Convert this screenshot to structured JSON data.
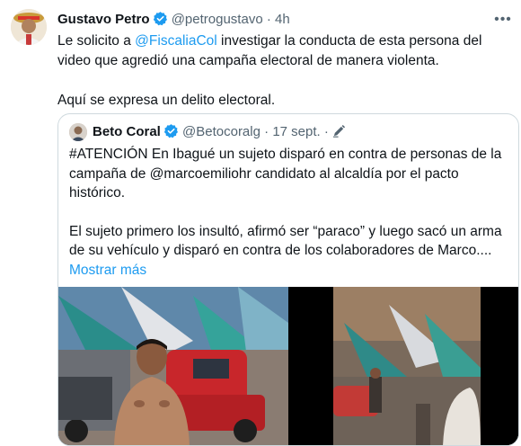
{
  "tweet": {
    "author_name": "Gustavo Petro",
    "handle": "@petrogustavo",
    "separator": "·",
    "time": "4h",
    "text_before": "Le solicito a ",
    "mention": "@FiscaliaCol",
    "text_after": " investigar la conducta de esta persona del video que agredió una campaña electoral de manera violenta.",
    "text_line2": "Aquí se expresa un delito electoral.",
    "more_icon": "more-dots-icon"
  },
  "quote": {
    "author_name": "Beto Coral",
    "handle": "@Betocoralg",
    "separator": "·",
    "date": "17 sept.",
    "separator2": "·",
    "edit_icon": "pencil-icon",
    "paragraph1": "#ATENCIÓN En Ibagué un sujeto disparó en contra de personas de la campaña de @marcoemiliohr candidato al alcaldía por el pacto histórico.",
    "paragraph2": "El sujeto primero los insultó, afirmó ser “paraco” y luego sacó un arma de su vehículo y disparó en contra de los colaboradores de Marco....",
    "show_more": "Mostrar más"
  },
  "colors": {
    "link": "#1d9bf0",
    "verified": "#1d9bf0",
    "muted": "#536471"
  }
}
